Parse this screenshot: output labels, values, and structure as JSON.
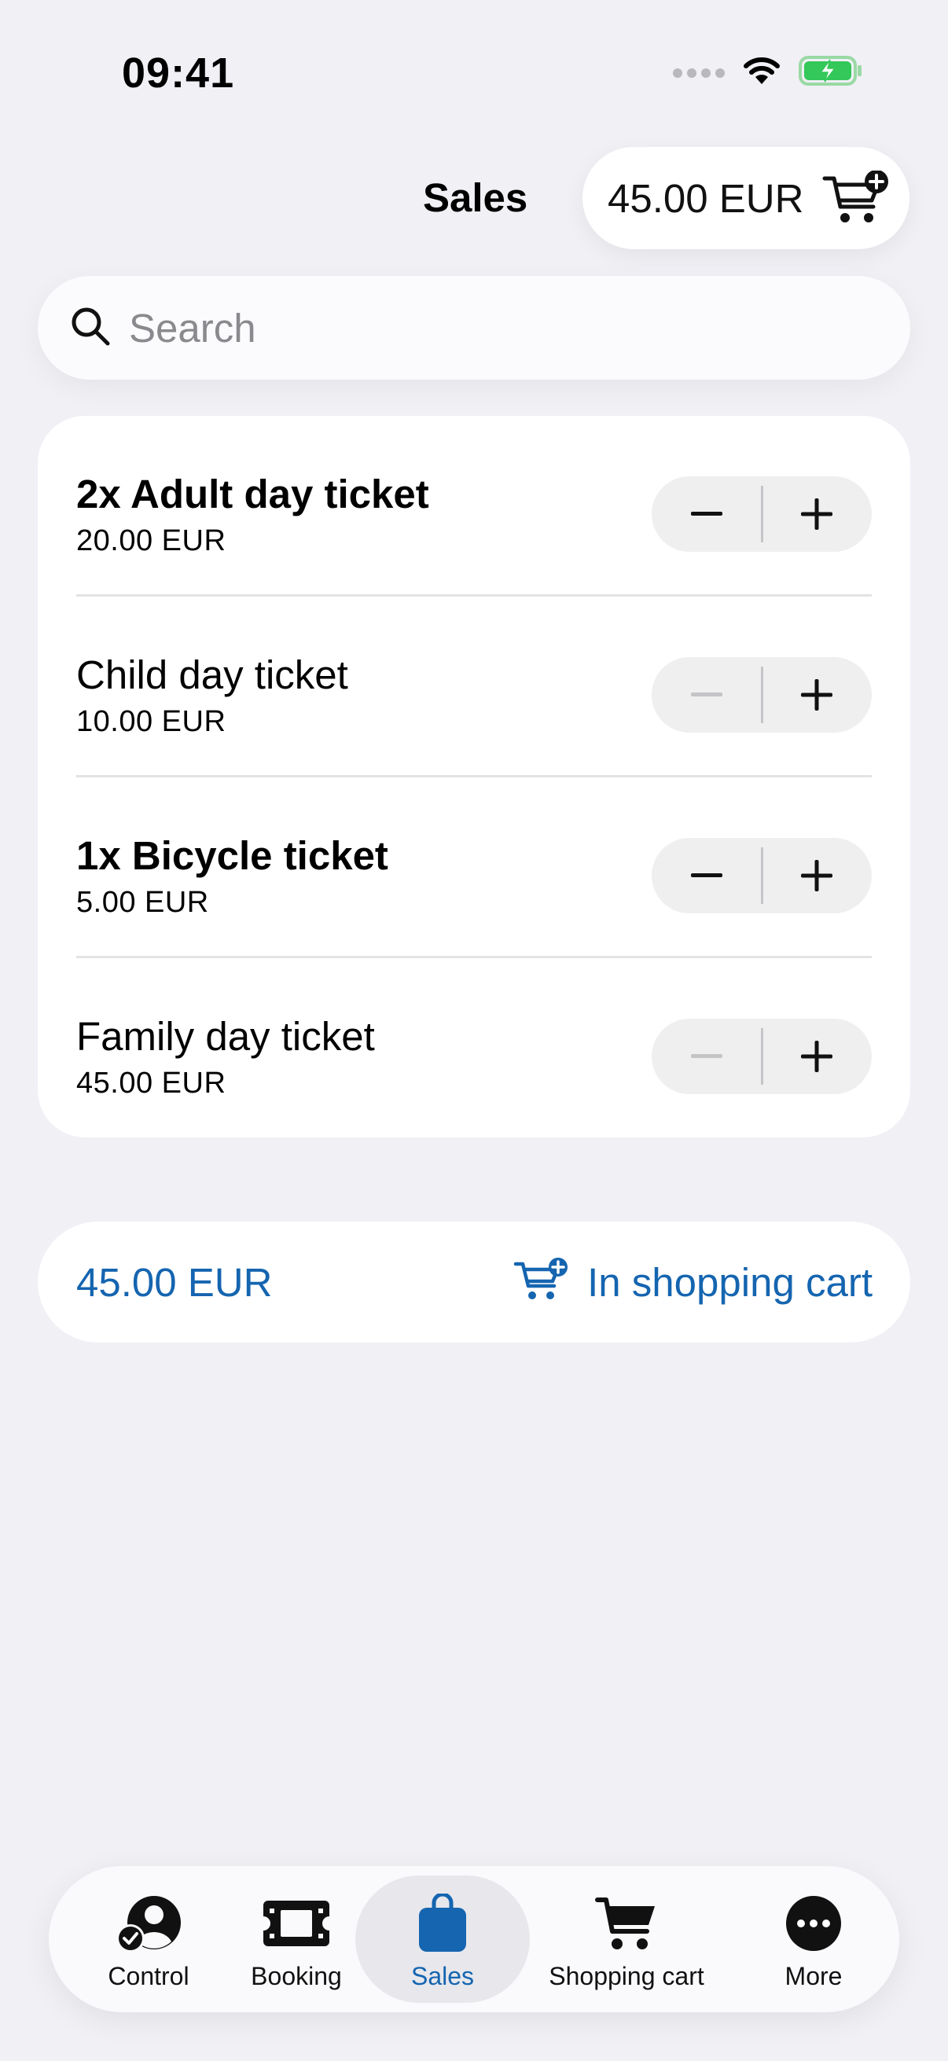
{
  "status_bar": {
    "time": "09:41"
  },
  "header": {
    "title": "Sales",
    "cart_total": "45.00 EUR"
  },
  "search": {
    "placeholder": "Search"
  },
  "tickets": [
    {
      "name": "2x Adult day ticket",
      "price": "20.00 EUR",
      "quantity": 2,
      "minus_enabled": true
    },
    {
      "name": "Child day ticket",
      "price": "10.00 EUR",
      "quantity": 0,
      "minus_enabled": false
    },
    {
      "name": "1x Bicycle ticket",
      "price": "5.00 EUR",
      "quantity": 1,
      "minus_enabled": true
    },
    {
      "name": "Family day ticket",
      "price": "45.00 EUR",
      "quantity": 0,
      "minus_enabled": false
    }
  ],
  "add_to_cart": {
    "total": "45.00 EUR",
    "label": "In shopping cart"
  },
  "tabs": [
    {
      "label": "Control",
      "icon": "person-check-icon",
      "active": false
    },
    {
      "label": "Booking",
      "icon": "ticket-icon",
      "active": false
    },
    {
      "label": "Sales",
      "icon": "shopping-bag-icon",
      "active": true
    },
    {
      "label": "Shopping cart",
      "icon": "cart-icon",
      "active": false
    },
    {
      "label": "More",
      "icon": "more-icon",
      "active": false
    }
  ],
  "colors": {
    "accent": "#1565b0",
    "background": "#f0f0f5",
    "battery_green": "#34c759",
    "disabled": "#b8b8bd"
  }
}
